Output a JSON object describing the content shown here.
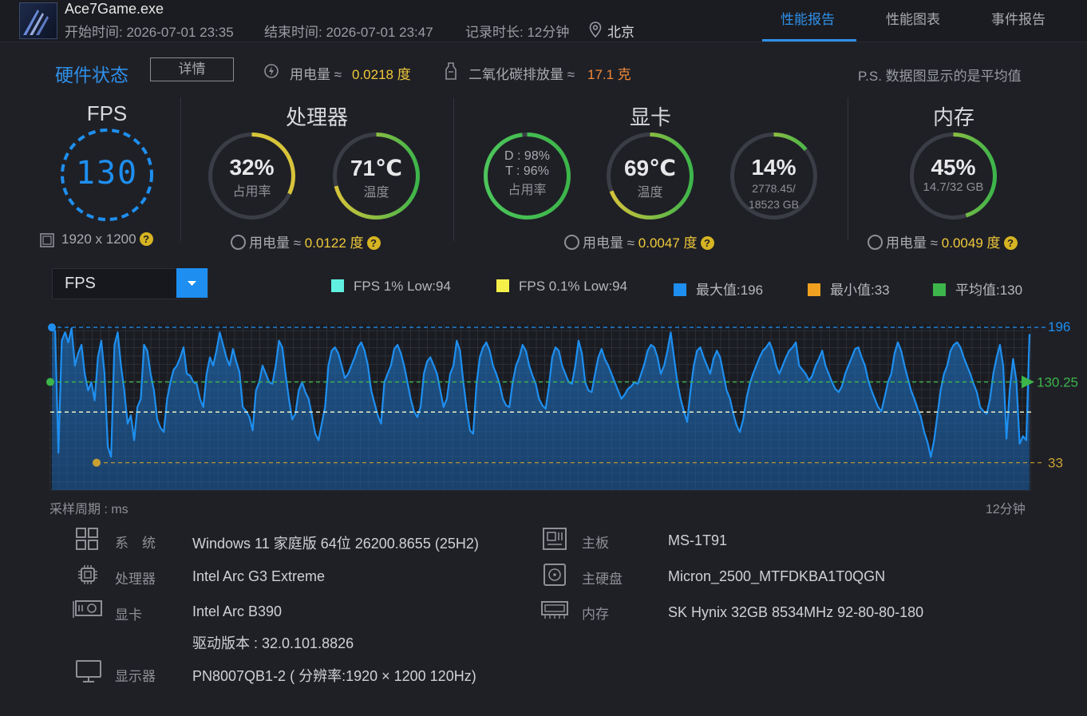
{
  "header": {
    "app_title": "Ace7Game.exe",
    "start_time": "开始时间: 2026-07-01 23:35",
    "end_time": "结束时间: 2026-07-01 23:47",
    "duration": "记录时长: 12分钟",
    "location": "北京",
    "tabs": [
      "性能报告",
      "性能图表",
      "事件报告"
    ]
  },
  "hardware": {
    "title": "硬件状态",
    "detail_button": "详情",
    "power_label": "用电量 ≈",
    "power_value": "0.0218 度",
    "co2_label": "二氧化碳排放量 ≈",
    "co2_value": "17.1 克",
    "note": "P.S. 数据图显示的是平均值"
  },
  "fps": {
    "title": "FPS",
    "value": "130",
    "resolution": "1920 x 1200"
  },
  "cpu": {
    "title": "处理器",
    "usage_value": "32%",
    "usage_label": "占用率",
    "usage_fraction": 0.32,
    "temp_value": "71℃",
    "temp_label": "温度",
    "temp_fraction": 0.71,
    "power_label": "用电量 ≈",
    "power_value": "0.0122 度"
  },
  "gpu": {
    "title": "显卡",
    "d_line": "D : 98%",
    "t_line": "T : 96%",
    "usage_label": "占用率",
    "usage_fraction": 0.98,
    "temp_value": "69℃",
    "temp_label": "温度",
    "temp_fraction": 0.69,
    "mem_value": "14%",
    "mem_line1": "2778.45/",
    "mem_line2": "18523 GB",
    "mem_fraction": 0.14,
    "power_label": "用电量 ≈",
    "power_value": "0.0047 度"
  },
  "memory": {
    "title": "内存",
    "usage_value": "45%",
    "usage_detail": "14.7/32 GB",
    "usage_fraction": 0.45,
    "power_label": "用电量 ≈",
    "power_value": "0.0049 度"
  },
  "metric_select": {
    "value": "FPS"
  },
  "legend": [
    {
      "label": "FPS 1% Low:94",
      "color": "#5ff0e0"
    },
    {
      "label": "FPS 0.1% Low:94",
      "color": "#f5ef4a"
    },
    {
      "label": "最大值:196",
      "color": "#1e8ff0"
    },
    {
      "label": "最小值:33",
      "color": "#f0a020"
    },
    {
      "label": "平均值:130",
      "color": "#3cb54a"
    }
  ],
  "chart_data": {
    "type": "area",
    "ylim": [
      0,
      200
    ],
    "max_label": "196",
    "avg_label": "130.25",
    "min_label": "33",
    "max": 196,
    "avg": 130.25,
    "min": 33,
    "low_1pct": 94,
    "xlabel_left": "采样周期 : ms",
    "xlabel_right": "12分钟",
    "values": [
      196,
      192,
      45,
      180,
      190,
      178,
      195,
      150,
      165,
      175,
      140,
      120,
      130,
      108,
      160,
      180,
      140,
      52,
      40,
      175,
      190,
      150,
      120,
      80,
      90,
      60,
      100,
      110,
      175,
      168,
      140,
      120,
      85,
      75,
      70,
      110,
      130,
      145,
      150,
      160,
      172,
      140,
      138,
      130,
      128,
      110,
      100,
      140,
      160,
      150,
      168,
      190,
      175,
      160,
      150,
      170,
      155,
      142,
      100,
      95,
      88,
      72,
      120,
      130,
      150,
      140,
      130,
      128,
      150,
      180,
      172,
      140,
      110,
      85,
      92,
      120,
      130,
      118,
      110,
      90,
      68,
      60,
      80,
      100,
      150,
      168,
      172,
      165,
      150,
      135,
      140,
      150,
      160,
      172,
      178,
      168,
      150,
      120,
      105,
      90,
      80,
      130,
      140,
      150,
      170,
      175,
      165,
      150,
      130,
      110,
      95,
      88,
      100,
      140,
      155,
      160,
      150,
      140,
      120,
      100,
      110,
      140,
      150,
      180,
      168,
      130,
      98,
      72,
      68,
      128,
      160,
      172,
      178,
      168,
      150,
      140,
      128,
      110,
      102,
      100,
      130,
      150,
      160,
      175,
      168,
      150,
      138,
      128,
      110,
      102,
      98,
      125,
      160,
      172,
      168,
      150,
      140,
      130,
      128,
      150,
      180,
      165,
      130,
      120,
      118,
      140,
      160,
      170,
      158,
      150,
      140,
      130,
      120,
      110,
      115,
      122,
      125,
      130,
      128,
      140,
      152,
      168,
      175,
      172,
      160,
      140,
      150,
      168,
      190,
      160,
      130,
      110,
      95,
      82,
      120,
      150,
      168,
      172,
      160,
      150,
      140,
      158,
      168,
      160,
      140,
      120,
      110,
      92,
      78,
      70,
      85,
      110,
      128,
      140,
      150,
      160,
      168,
      172,
      178,
      168,
      150,
      140,
      150,
      160,
      168,
      172,
      178,
      150,
      145,
      140,
      132,
      138,
      150,
      158,
      168,
      150,
      140,
      130,
      122,
      118,
      125,
      140,
      150,
      160,
      170,
      172,
      160,
      150,
      132,
      120,
      110,
      100,
      95,
      112,
      130,
      140,
      165,
      178,
      168,
      150,
      135,
      120,
      110,
      98,
      88,
      70,
      58,
      40,
      60,
      90,
      120,
      140,
      150,
      168,
      175,
      178,
      172,
      160,
      150,
      140,
      128,
      118,
      100,
      95,
      92,
      110,
      140,
      160,
      175,
      150,
      62,
      122,
      158,
      132,
      56,
      65,
      60,
      188
    ]
  },
  "specs": {
    "os_label": "系　统",
    "os_value": "Windows 11 家庭版 64位 26200.8655 (25H2)",
    "cpu_label": "处理器",
    "cpu_value": "Intel Arc G3 Extreme",
    "gpu_label": "显卡",
    "gpu_value": "Intel Arc B390",
    "driver_value": "驱动版本 : 32.0.101.8826",
    "monitor_label": "显示器",
    "monitor_value": "PN8007QB1-2 ( 分辨率:1920 × 1200 120Hz)",
    "board_label": "主板",
    "board_value": "MS-1T91",
    "disk_label": "主硬盘",
    "disk_value": "Micron_2500_MTFDKBA1T0QGN",
    "mem_label": "内存",
    "mem_value": "SK Hynix 32GB 8534MHz 92-80-80-180"
  }
}
